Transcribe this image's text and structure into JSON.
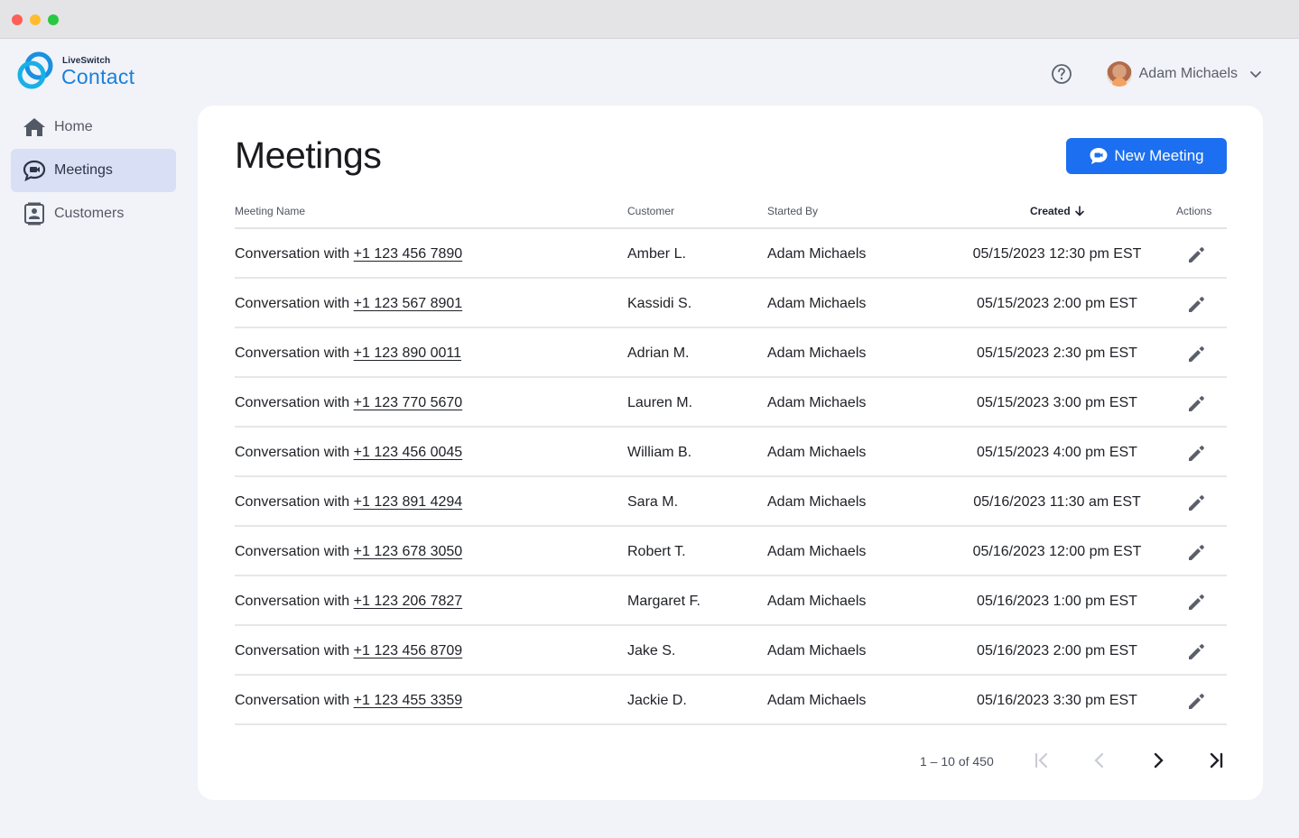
{
  "brand": {
    "small": "LiveSwitch",
    "big": "Contact",
    "color": "#1a7fdc"
  },
  "nav": {
    "items": [
      {
        "label": "Home",
        "icon": "home-icon",
        "active": false
      },
      {
        "label": "Meetings",
        "icon": "video-chat-icon",
        "active": true
      },
      {
        "label": "Customers",
        "icon": "contact-card-icon",
        "active": false
      }
    ]
  },
  "header": {
    "user_name": "Adam Michaels",
    "help_icon": "help-circle-icon",
    "menu_icon": "chevron-down-icon"
  },
  "main": {
    "title": "Meetings",
    "new_button_label": "New Meeting",
    "accent": "#1c6ff0"
  },
  "table": {
    "columns": {
      "name": "Meeting Name",
      "customer": "Customer",
      "started_by": "Started By",
      "created": "Created",
      "actions": "Actions"
    },
    "sort": {
      "column": "created",
      "direction": "descending",
      "icon": "arrow-down-icon"
    },
    "row_prefix": "Conversation with ",
    "rows": [
      {
        "phone": "+1 123 456 7890",
        "customer": "Amber L.",
        "started_by": "Adam Michaels",
        "created": "05/15/2023 12:30 pm EST"
      },
      {
        "phone": "+1 123 567 8901",
        "customer": "Kassidi S.",
        "started_by": "Adam Michaels",
        "created": "05/15/2023 2:00 pm EST"
      },
      {
        "phone": "+1 123 890 0011",
        "customer": "Adrian M.",
        "started_by": "Adam Michaels",
        "created": "05/15/2023 2:30 pm EST"
      },
      {
        "phone": "+1 123 770 5670",
        "customer": "Lauren M.",
        "started_by": "Adam Michaels",
        "created": "05/15/2023 3:00 pm EST"
      },
      {
        "phone": "+1 123 456 0045",
        "customer": "William B.",
        "started_by": "Adam Michaels",
        "created": "05/15/2023 4:00 pm EST"
      },
      {
        "phone": "+1 123 891 4294",
        "customer": "Sara M.",
        "started_by": "Adam Michaels",
        "created": "05/16/2023 11:30 am EST"
      },
      {
        "phone": "+1 123 678 3050",
        "customer": "Robert T.",
        "started_by": "Adam Michaels",
        "created": "05/16/2023 12:00 pm EST"
      },
      {
        "phone": "+1 123 206 7827",
        "customer": "Margaret F.",
        "started_by": "Adam Michaels",
        "created": "05/16/2023 1:00 pm EST"
      },
      {
        "phone": "+1 123 456 8709",
        "customer": "Jake S.",
        "started_by": "Adam Michaels",
        "created": "05/16/2023 2:00 pm EST"
      },
      {
        "phone": "+1 123 455 3359",
        "customer": "Jackie D.",
        "started_by": "Adam Michaels",
        "created": "05/16/2023 3:30 pm EST"
      }
    ],
    "row_action_icon": "pencil-edit-icon"
  },
  "pagination": {
    "range_label": "1 – 10 of 450"
  }
}
